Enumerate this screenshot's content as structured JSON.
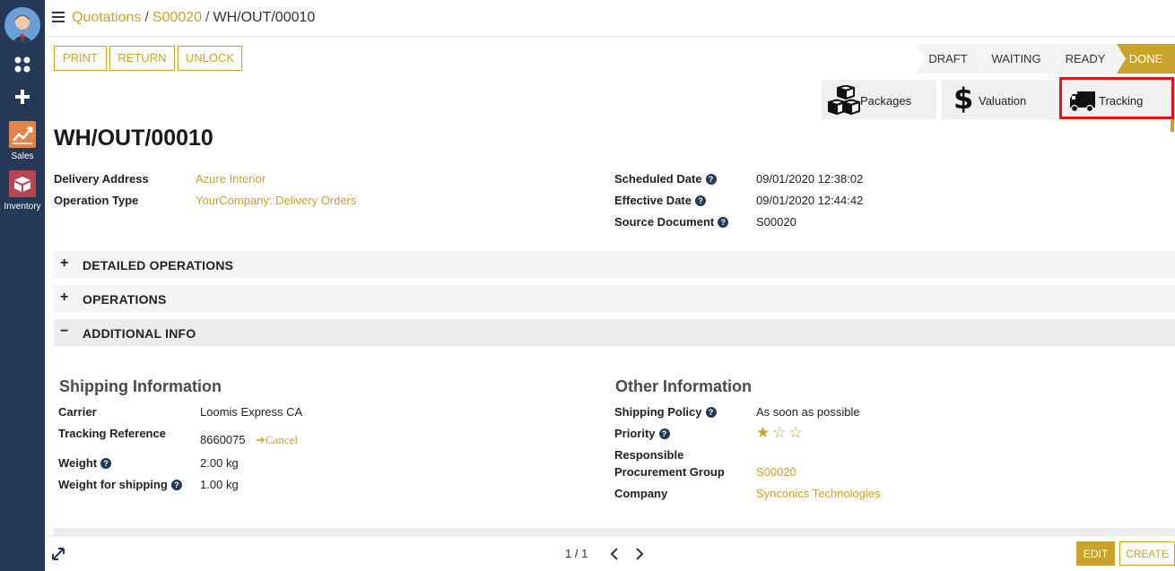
{
  "sidebar": {
    "apps": [
      {
        "label": "Sales",
        "icon": "sales-chart-icon",
        "color": "#e2844c"
      },
      {
        "label": "Inventory",
        "icon": "inventory-box-icon",
        "color": "#b6474f"
      }
    ]
  },
  "breadcrumb": {
    "items": [
      "Quotations",
      "S00020"
    ],
    "current": "WH/OUT/00010"
  },
  "actions": {
    "print": "PRINT",
    "return": "RETURN",
    "unlock": "UNLOCK"
  },
  "statusbar": {
    "stages": [
      "DRAFT",
      "WAITING",
      "READY",
      "DONE"
    ],
    "active": "DONE",
    "active_color": "#c9a32b"
  },
  "smart_buttons": {
    "packages": "Packages",
    "valuation": "Valuation",
    "tracking": "Tracking"
  },
  "record": {
    "title": "WH/OUT/00010",
    "left_fields": [
      {
        "label": "Delivery Address",
        "value": "Azure Interior"
      },
      {
        "label": "Operation Type",
        "value": "YourCompany: Delivery Orders"
      }
    ],
    "right_fields": [
      {
        "label": "Scheduled Date",
        "value": "09/01/2020 12:38:02"
      },
      {
        "label": "Effective Date",
        "value": "09/01/2020 12:44:42"
      },
      {
        "label": "Source Document",
        "value": "S00020"
      }
    ]
  },
  "sections": {
    "detailed": "DETAILED OPERATIONS",
    "operations": "OPERATIONS",
    "additional": "ADDITIONAL INFO"
  },
  "shipping": {
    "heading": "Shipping Information",
    "carrier_label": "Carrier",
    "carrier": "Loomis Express CA",
    "tracking_label": "Tracking Reference",
    "tracking": "8660075",
    "cancel": "Cancel",
    "weight_label": "Weight",
    "weight": "2.00",
    "weight_unit": "kg",
    "shipweight_label": "Weight for shipping",
    "shipweight": "1.00",
    "shipweight_unit": "kg"
  },
  "other": {
    "heading": "Other Information",
    "policy_label": "Shipping Policy",
    "policy": "As soon as possible",
    "priority_label": "Priority",
    "priority_stars": 1,
    "priority_max": 3,
    "responsible_label": "Responsible",
    "procurement_label": "Procurement Group",
    "procurement": "S00020",
    "company_label": "Company",
    "company": "Synconics Technologies"
  },
  "footer": {
    "pager": "1 / 1",
    "edit": "EDIT",
    "create": "CREATE"
  }
}
